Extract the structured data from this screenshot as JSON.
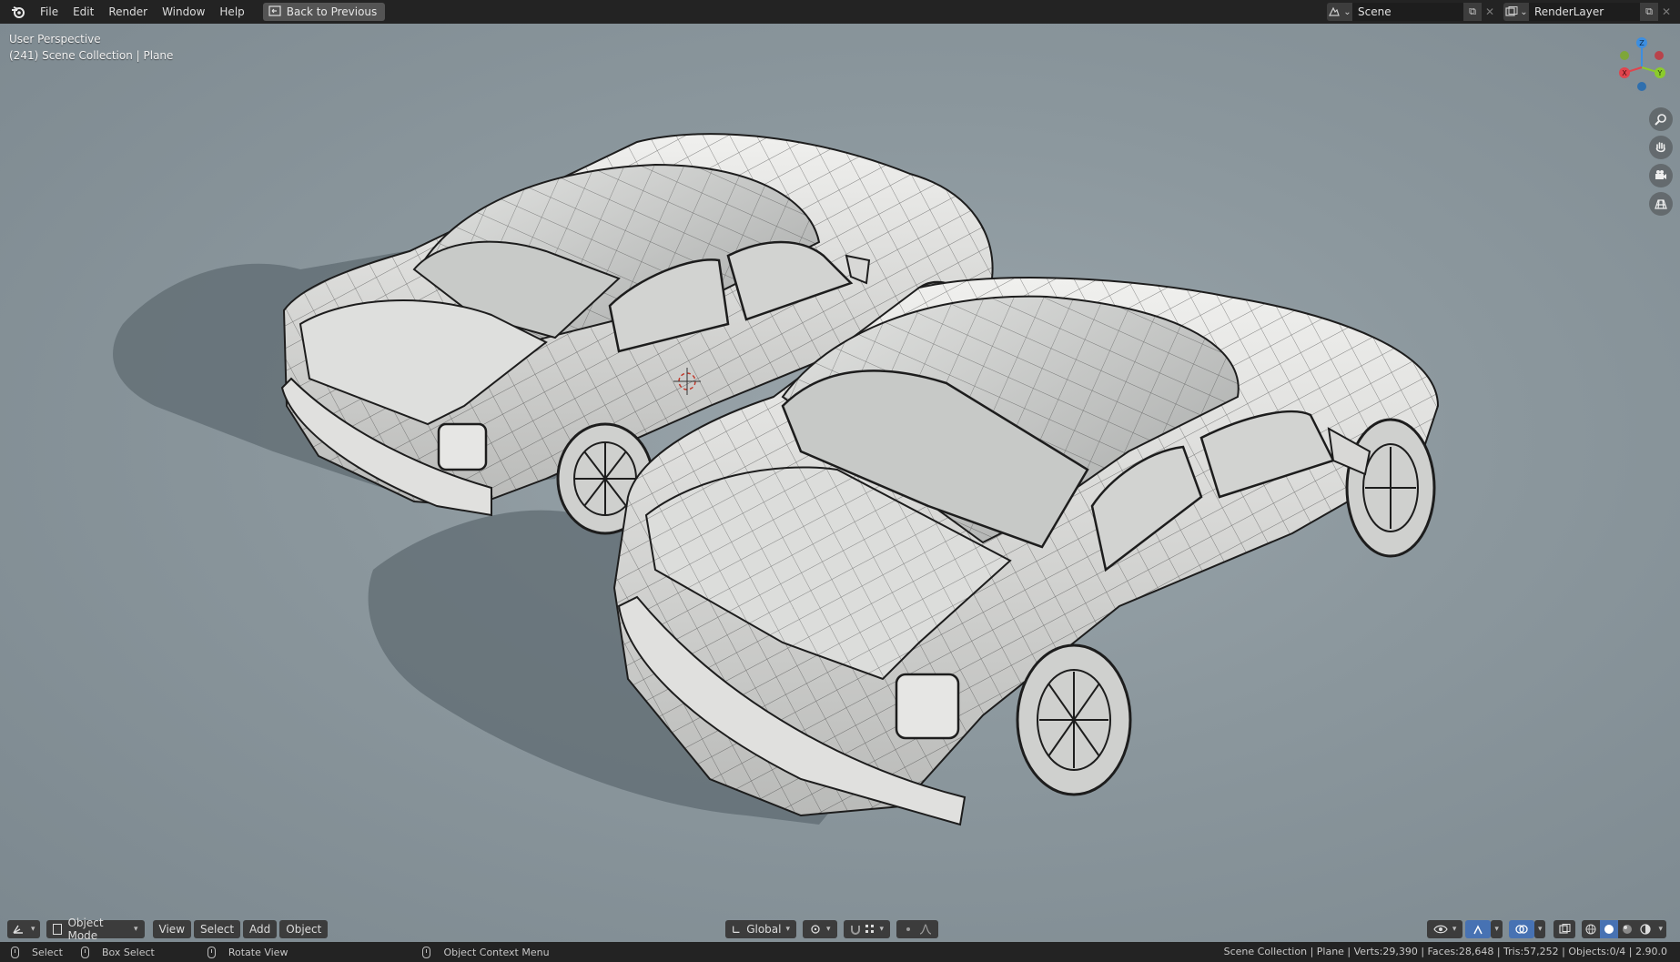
{
  "topbar": {
    "menus": [
      "File",
      "Edit",
      "Render",
      "Window",
      "Help"
    ],
    "back_button": "Back to Previous",
    "scene_name": "Scene",
    "layer_name": "RenderLayer"
  },
  "viewport": {
    "perspective": "User Perspective",
    "collection": "(241) Scene Collection | Plane",
    "gizmo_axes": {
      "x": "X",
      "y": "Y",
      "z": "Z"
    }
  },
  "header": {
    "mode": "Object Mode",
    "view": "View",
    "select": "Select",
    "add": "Add",
    "object": "Object",
    "orientation": "Global"
  },
  "statusbar": {
    "select": "Select",
    "box_select": "Box Select",
    "rotate_view": "Rotate View",
    "context_menu": "Object Context Menu",
    "stats": "Scene Collection | Plane | Verts:29,390 | Faces:28,648 | Tris:57,252 | Objects:0/4 | 2.90.0"
  },
  "colors": {
    "axis_x": "#e0454e",
    "axis_y": "#8bcb2c",
    "axis_z": "#3d8ee0",
    "topbar": "#232323",
    "viewport": "#8b979d"
  }
}
